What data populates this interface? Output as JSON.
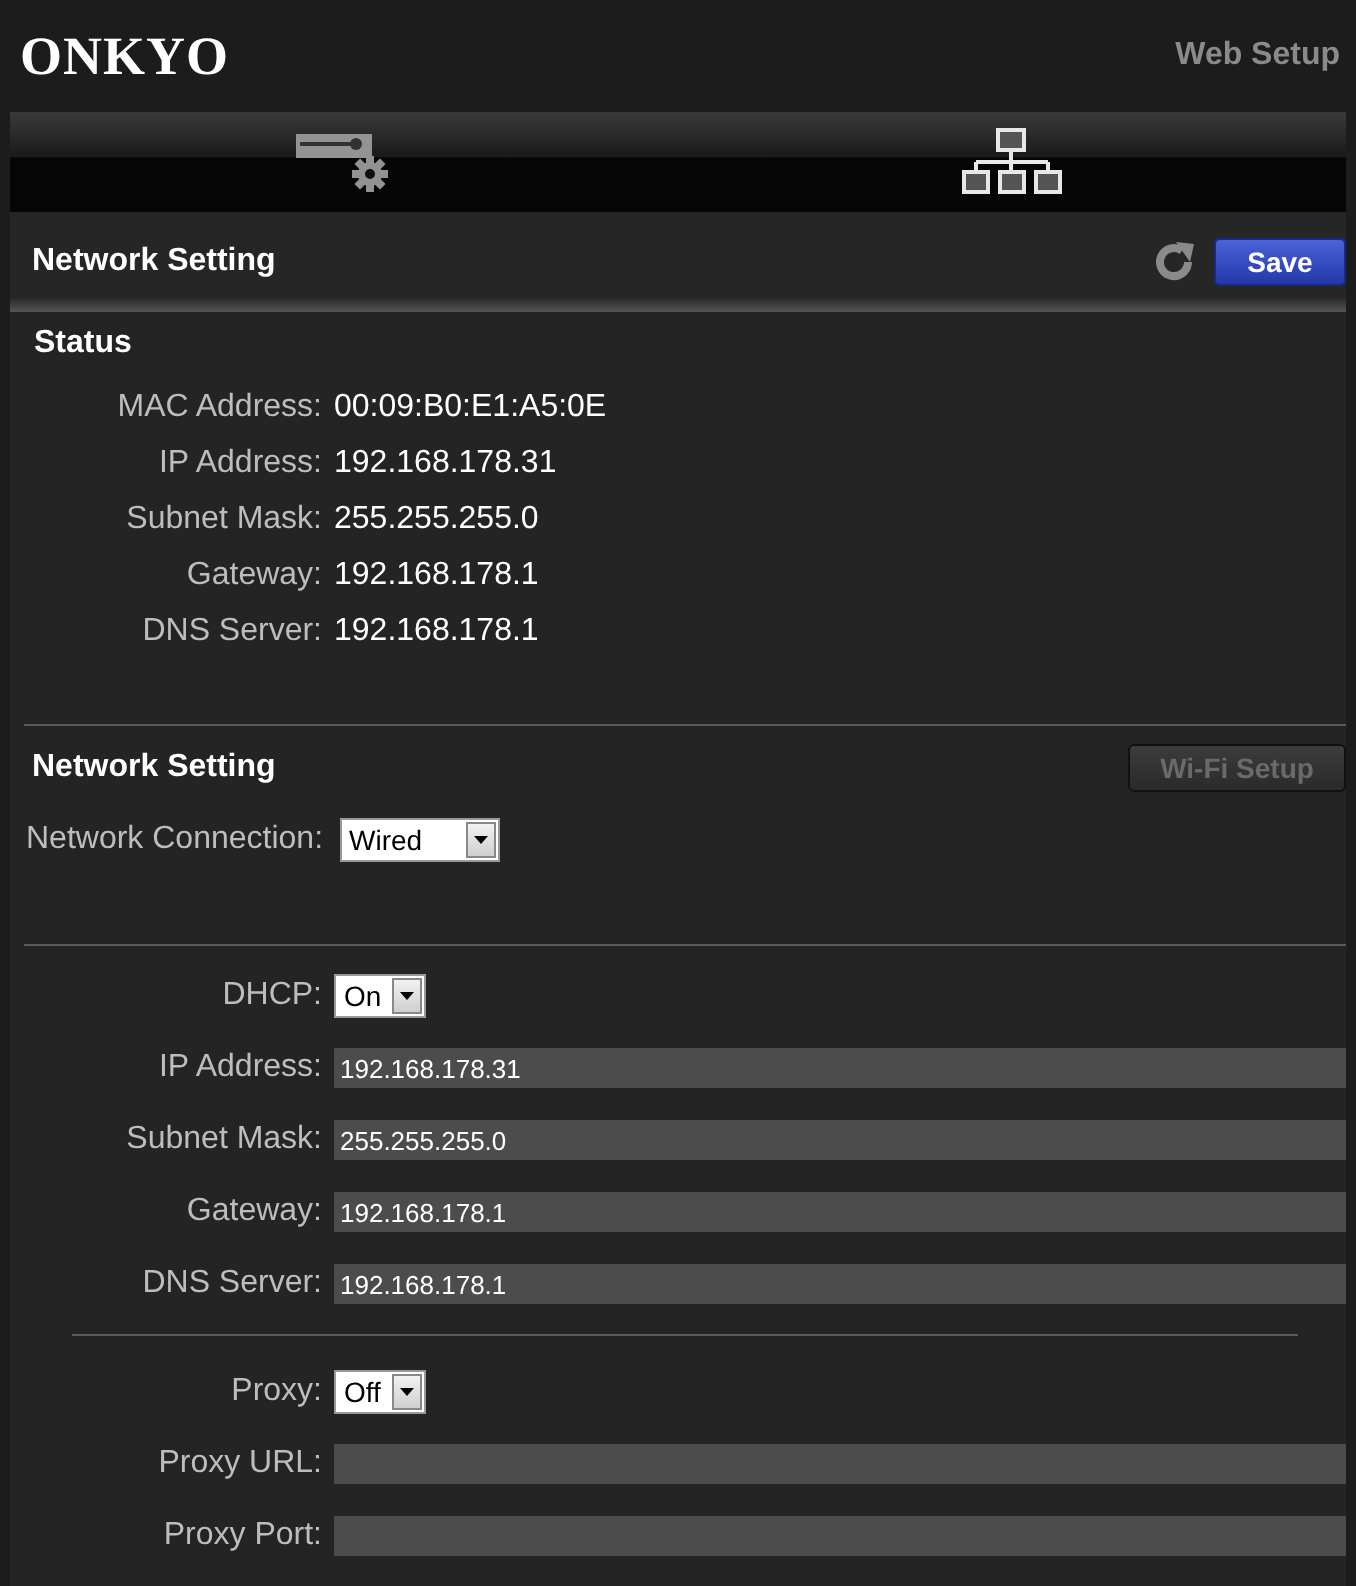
{
  "header": {
    "logo": "ONKYO",
    "title": "Web Setup"
  },
  "tabs": [
    {
      "kind": "device",
      "selected": false
    },
    {
      "kind": "network",
      "selected": true
    }
  ],
  "page_title": "Network Setting",
  "save_button": "Save",
  "status": {
    "heading": "Status",
    "rows": [
      {
        "label": "MAC Address:",
        "value": "00:09:B0:E1:A5:0E"
      },
      {
        "label": "IP Address:",
        "value": "192.168.178.31"
      },
      {
        "label": "Subnet Mask:",
        "value": "255.255.255.0"
      },
      {
        "label": "Gateway:",
        "value": "192.168.178.1"
      },
      {
        "label": "DNS Server:",
        "value": "192.168.178.1"
      }
    ]
  },
  "network_setting": {
    "heading": "Network Setting",
    "wifi_button": {
      "label": "Wi-Fi Setup",
      "disabled": true
    },
    "connection": {
      "label": "Network Connection:",
      "value": "Wired"
    }
  },
  "ip_settings": [
    {
      "kind": "select",
      "label": "DHCP:",
      "value": "On"
    },
    {
      "kind": "field",
      "label": "IP Address:",
      "value": "192.168.178.31"
    },
    {
      "kind": "field",
      "label": "Subnet Mask:",
      "value": "255.255.255.0"
    },
    {
      "kind": "field",
      "label": "Gateway:",
      "value": "192.168.178.1"
    },
    {
      "kind": "field",
      "label": "DNS Server:",
      "value": "192.168.178.1"
    }
  ],
  "proxy_settings": [
    {
      "kind": "select",
      "label": "Proxy:",
      "value": "Off"
    },
    {
      "kind": "field",
      "label": "Proxy URL:"
    },
    {
      "kind": "field",
      "label": "Proxy Port:"
    }
  ]
}
